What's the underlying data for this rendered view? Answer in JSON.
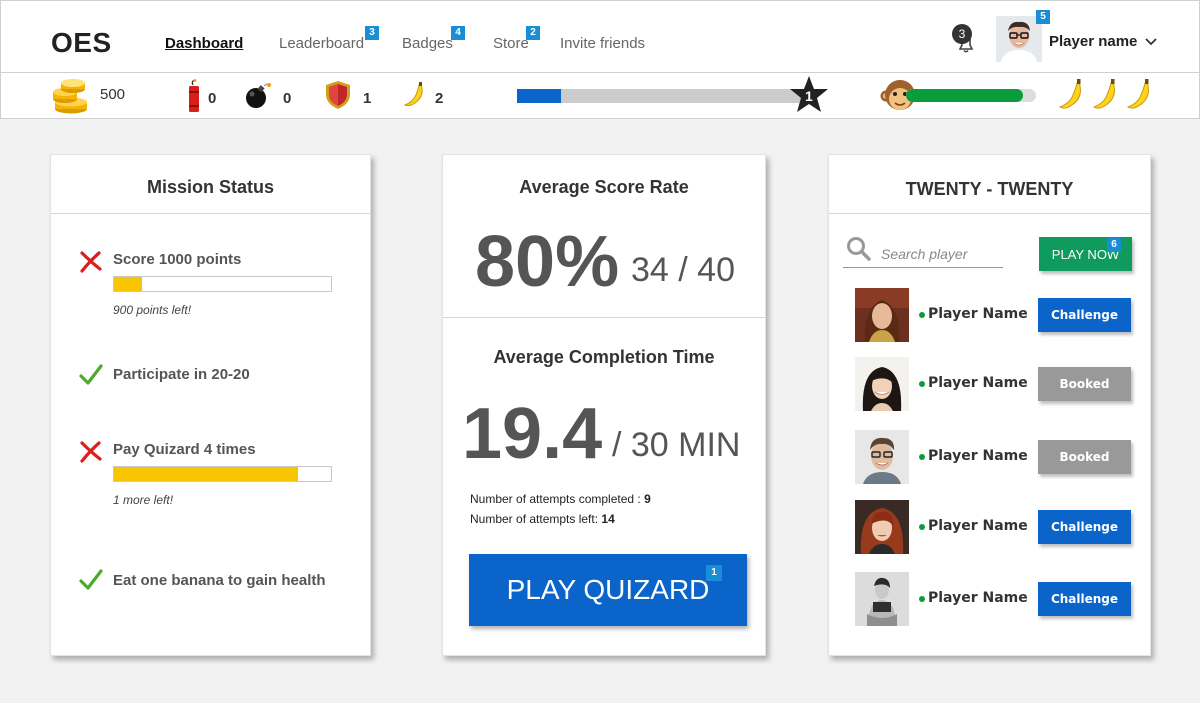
{
  "nav": {
    "logo": "OES",
    "links": [
      {
        "label": "Dashboard",
        "badge": ""
      },
      {
        "label": "Leaderboard",
        "badge": "3"
      },
      {
        "label": "Badges",
        "badge": "4"
      },
      {
        "label": "Store",
        "badge": "2"
      },
      {
        "label": "Invite friends",
        "badge": ""
      }
    ],
    "notifications": "3",
    "profile_badge": "5",
    "player_name": "Player name"
  },
  "stats": {
    "coins": "500",
    "dynamite": "0",
    "bombs": "0",
    "shields": "1",
    "bananas": "2",
    "level": "1",
    "level_progress": 0.15,
    "health_progress": 0.9,
    "banana_lives": 3
  },
  "mission": {
    "title": "Mission Status",
    "items": [
      {
        "label": "Score 1000 points",
        "done": false,
        "progress": 0.13,
        "note": "900 points left!"
      },
      {
        "label": "Participate in 20-20",
        "done": true
      },
      {
        "label": "Pay Quizard 4 times",
        "done": false,
        "progress": 0.85,
        "note": "1 more left!"
      },
      {
        "label": "Eat one banana to gain health",
        "done": true
      }
    ]
  },
  "score": {
    "title": "Average Score Rate",
    "rate": "80%",
    "fraction": "34 / 40",
    "completion_title": "Average Completion Time",
    "time": "19.4",
    "time_total": "/ 30 MIN",
    "attempts_completed_label": "Number of attempts completed : ",
    "attempts_completed": "9",
    "attempts_left_label": "Number of attempts left: ",
    "attempts_left": "14",
    "play_label": "PLAY QUIZARD",
    "play_badge": "1"
  },
  "twenty": {
    "title": "TWENTY - TWENTY",
    "search_placeholder": "Search player",
    "play_now": "PLAY NOW",
    "play_now_badge": "6",
    "players": [
      {
        "name": "Player Name",
        "action": "Challenge",
        "status": "available"
      },
      {
        "name": "Player Name",
        "action": "Booked",
        "status": "booked"
      },
      {
        "name": "Player Name",
        "action": "Booked",
        "status": "booked"
      },
      {
        "name": "Player Name",
        "action": "Challenge",
        "status": "available"
      },
      {
        "name": "Player Name",
        "action": "Challenge",
        "status": "available"
      }
    ]
  },
  "colors": {
    "primary": "#0a64c9",
    "success": "#0a9c3c",
    "play_now": "#0f9a5e",
    "booked": "#999999",
    "badge": "#1a8ed4",
    "progress": "#f7c600"
  }
}
